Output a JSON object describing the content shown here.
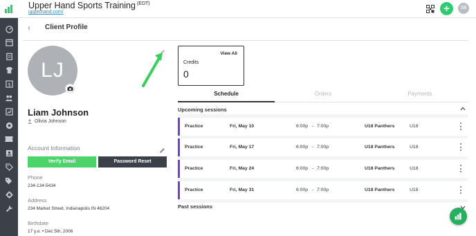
{
  "header": {
    "app_title": "Upper Hand Sports Training",
    "title_badge": "(EDT)",
    "app_url": "upperhand.com/",
    "add_label": "+",
    "user_initials": "SB"
  },
  "page": {
    "back_glyph": "‹",
    "title": "Client Profile"
  },
  "profile": {
    "initials": "LJ",
    "name": "Liam Johnson",
    "managed_by": "Olivia Johnson"
  },
  "account": {
    "title": "Account Information",
    "verify_label": "Verify Email",
    "password_label": "Password Reset",
    "phone_label": "Phone",
    "phone": "234-134-5434",
    "address_label": "Address",
    "address": "234 Market Street, Indianapolis IN 46204",
    "birthdate_label": "Birthdate",
    "birthdate": "17 y.o. • Dec 5th, 2006"
  },
  "credits": {
    "view_all": "View All",
    "label": "Credits",
    "value": "0"
  },
  "tabs": [
    {
      "label": "Schedule",
      "active": true
    },
    {
      "label": "Orders",
      "active": false
    },
    {
      "label": "Payments",
      "active": false
    }
  ],
  "upcoming": {
    "title": "Upcoming sessions",
    "sessions": [
      {
        "type": "Practice",
        "date": "Fri, May 10",
        "start": "6:00p",
        "sep": "-",
        "end": "7:00p",
        "team": "U18 Panthers",
        "group": "U18"
      },
      {
        "type": "Practice",
        "date": "Fri, May 17",
        "start": "6:00p",
        "sep": "-",
        "end": "7:00p",
        "team": "U18 Panthers",
        "group": "U18"
      },
      {
        "type": "Practice",
        "date": "Fri, May 24",
        "start": "6:00p",
        "sep": "-",
        "end": "7:00p",
        "team": "U18 Panthers",
        "group": "U18"
      },
      {
        "type": "Practice",
        "date": "Fri, May 31",
        "start": "6:00p",
        "sep": "-",
        "end": "7:00p",
        "team": "U18 Panthers",
        "group": "U18"
      }
    ]
  },
  "past": {
    "title": "Past sessions"
  },
  "colors": {
    "sidebar": "#3c4149",
    "accent_green": "#2ecc71",
    "verify_green": "#4cd36a",
    "session_accent": "#6b46c1",
    "link_blue": "#2a8dd4"
  },
  "icons": {
    "sidebar": [
      "dashboard-icon",
      "calendar-icon",
      "clipboard-icon",
      "shirt-icon",
      "dollar-icon",
      "people-icon",
      "chart-icon",
      "globe-icon",
      "ticket-icon",
      "contact-card-icon",
      "tag-icon",
      "tags-icon",
      "gear-icon",
      "wrench-icon"
    ]
  }
}
